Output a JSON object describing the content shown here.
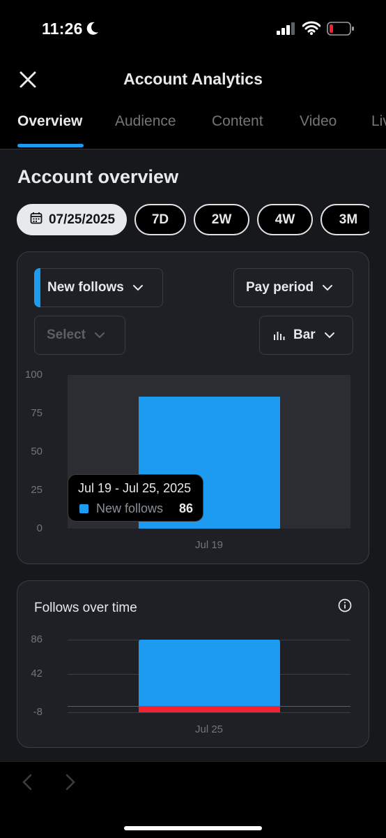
{
  "status_bar": {
    "time": "11:26"
  },
  "header": {
    "title": "Account Analytics"
  },
  "tabs": [
    {
      "label": "Overview",
      "active": true
    },
    {
      "label": "Audience",
      "active": false
    },
    {
      "label": "Content",
      "active": false
    },
    {
      "label": "Video",
      "active": false
    },
    {
      "label": "Live",
      "active": false
    }
  ],
  "overview": {
    "title": "Account overview",
    "date_chips": [
      "07/25/2025",
      "7D",
      "2W",
      "4W",
      "3M"
    ]
  },
  "controls": {
    "metric": "New follows",
    "period": "Pay period",
    "select_placeholder": "Select",
    "chart_type": "Bar"
  },
  "tooltip": {
    "date_range": "Jul 19 - Jul 25, 2025",
    "series_name": "New follows",
    "value": "86"
  },
  "follows_card": {
    "title": "Follows over time"
  },
  "colors": {
    "accent": "#1d9bf0",
    "negative": "#f4212e",
    "background": "#000000",
    "card": "#1e2025"
  },
  "chart_data": [
    {
      "type": "bar",
      "categories": [
        "Jul 19"
      ],
      "series": [
        {
          "name": "New follows",
          "values": [
            86
          ]
        }
      ],
      "yticks": [
        "100",
        "75",
        "50",
        "25",
        "0"
      ],
      "ylim": [
        0,
        100
      ]
    },
    {
      "type": "bar",
      "title": "Follows over time",
      "categories": [
        "Jul 25"
      ],
      "series": [
        {
          "values": [
            86
          ]
        },
        {
          "values": [
            -8
          ]
        }
      ],
      "yticks": [
        "86",
        "42",
        "-8"
      ],
      "ylim": [
        -8,
        86
      ]
    }
  ]
}
